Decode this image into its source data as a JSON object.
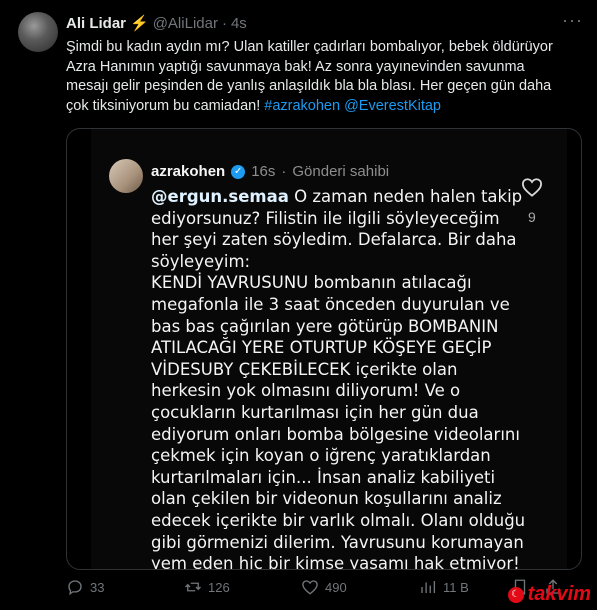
{
  "tweet": {
    "author": "Ali Lidar",
    "handle": "@AliLidar",
    "dot": "·",
    "time": "4s",
    "more": "···",
    "text_plain": "Şimdi bu kadın aydın mı? Ulan katiller çadırları bombalıyor, bebek öldürüyor\nAzra Hanımın yaptığı savunmaya bak!  Az sonra yayınevinden savunma\nmesajı gelir peşinden de yanlış anlaşıldık bla bla blası. Her geçen gün daha\nçok tiksiniyorum bu camiadan! ",
    "hashtag": "#azrakohen",
    "mention": "@EverestKitap"
  },
  "quote": {
    "username": "azrakohen",
    "time": "16s",
    "dot": "·",
    "author_label": "Gönderi sahibi",
    "mention": "@ergun.semaa",
    "text_intro": " O zaman neden halen takip\nediyorsunuz? Filistin ile ilgili söyleyeceğim\nher şeyi zaten söyledim. Defalarca. Bir daha\nsöyleyeyim:",
    "text_body": "KENDİ YAVRUSUNU bombanın atılacağı\nmegafonla ile 3 saat önceden duyurulan ve\nbas bas çağırılan yere götürüp BOMBANIN\nATILACAĞI YERE OTURTUP KÖŞEYE GEÇİP\nVİDESUBY ÇEKEBİLECEK içerikte olan\nherkesin yok olmasını diliyorum! Ve o\nçocukların kurtarılması için her gün dua\nediyorum onları bomba bölgesine videolarını\nçekmek için koyan o iğrenç yaratıklardan\nkurtarılmaları için... İnsan analiz kabiliyeti\nolan çekilen bir videonun koşullarını analiz\nedecek içerikte bir varlık olmalı. Olanı olduğu\ngibi görmenizi dilerim. Yavrusunu korumayan\nyem eden hiç bir kimse yaşamı hak etmiyor!",
    "likes": "9"
  },
  "actions": {
    "replies": "33",
    "reposts": "126",
    "likes": "490",
    "views": "11 B"
  },
  "watermark": {
    "text": "takvim",
    "icon": "crescent-star-icon"
  },
  "colors": {
    "background": "#000000",
    "accent": "#1d9bf0",
    "muted": "#71767b"
  }
}
